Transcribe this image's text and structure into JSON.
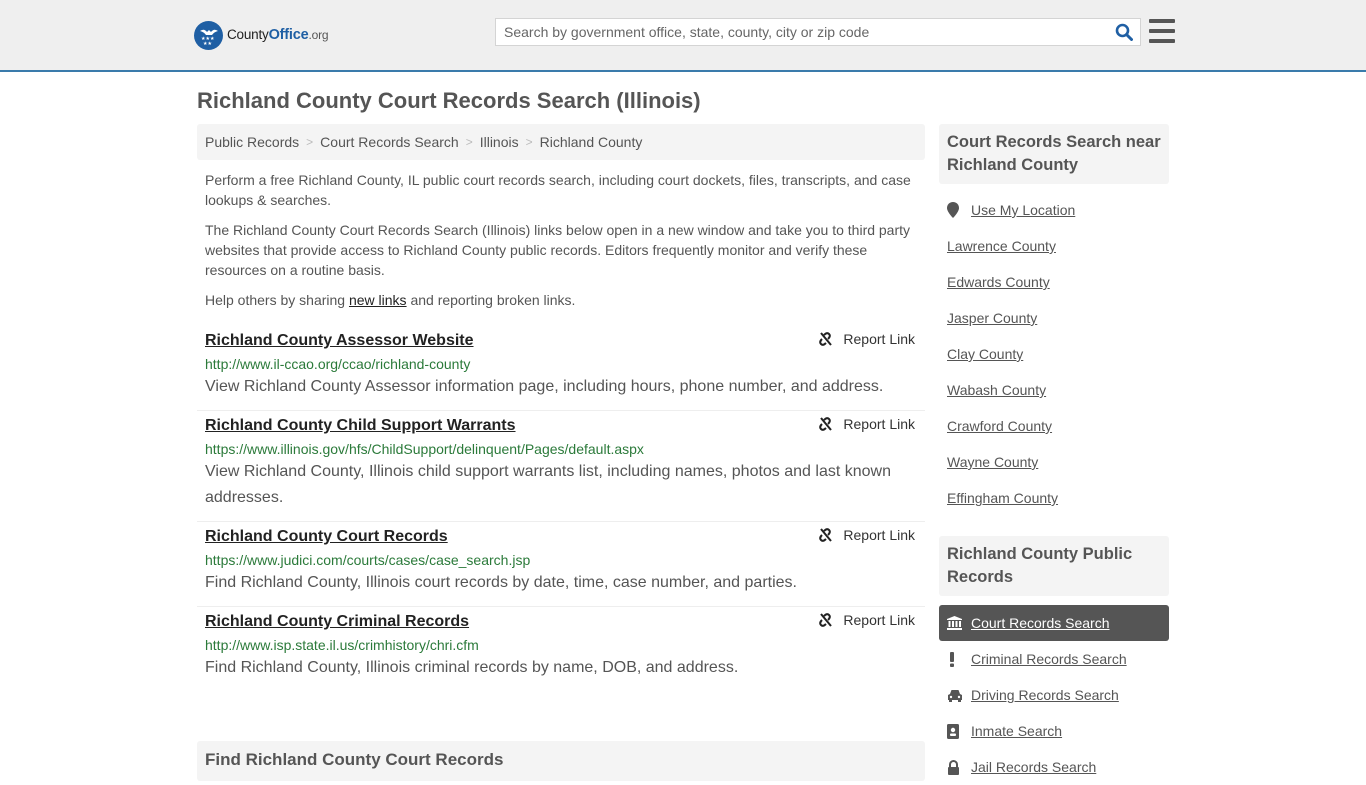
{
  "header": {
    "logo": {
      "name": "County",
      "accent": "Office",
      "tld": ".org"
    },
    "search_placeholder": "Search by government office, state, county, city or zip code"
  },
  "page_title": "Richland County Court Records Search (Illinois)",
  "breadcrumb": [
    "Public Records",
    "Court Records Search",
    "Illinois",
    "Richland County"
  ],
  "intro": {
    "p1": "Perform a free Richland County, IL public court records search, including court dockets, files, transcripts, and case lookups & searches.",
    "p2": "The Richland County Court Records Search (Illinois) links below open in a new window and take you to third party websites that provide access to Richland County public records. Editors frequently monitor and verify these resources on a routine basis.",
    "p3_before": "Help others by sharing ",
    "p3_link": "new links",
    "p3_after": " and reporting broken links."
  },
  "report_label": "Report Link",
  "links": [
    {
      "title": "Richland County Assessor Website",
      "url": "http://www.il-ccao.org/ccao/richland-county",
      "desc": "View Richland County Assessor information page, including hours, phone number, and address."
    },
    {
      "title": "Richland County Child Support Warrants",
      "url": "https://www.illinois.gov/hfs/ChildSupport/delinquent/Pages/default.aspx",
      "desc": "View Richland County, Illinois child support warrants list, including names, photos and last known addresses."
    },
    {
      "title": "Richland County Court Records",
      "url": "https://www.judici.com/courts/cases/case_search.jsp",
      "desc": "Find Richland County, Illinois court records by date, time, case number, and parties."
    },
    {
      "title": "Richland County Criminal Records",
      "url": "http://www.isp.state.il.us/crimhistory/chri.cfm",
      "desc": "Find Richland County, Illinois criminal records by name, DOB, and address."
    }
  ],
  "find_heading": "Find Richland County Court Records",
  "sidebar": {
    "nearby_heading": "Court Records Search near Richland County",
    "use_location": "Use My Location",
    "nearby": [
      "Lawrence County",
      "Edwards County",
      "Jasper County",
      "Clay County",
      "Wabash County",
      "Crawford County",
      "Wayne County",
      "Effingham County"
    ],
    "public_heading": "Richland County Public Records",
    "public_records": [
      {
        "label": "Court Records Search",
        "icon": "courthouse-icon",
        "active": true
      },
      {
        "label": "Criminal Records Search",
        "icon": "exclamation-icon",
        "active": false
      },
      {
        "label": "Driving Records Search",
        "icon": "car-icon",
        "active": false
      },
      {
        "label": "Inmate Search",
        "icon": "id-badge-icon",
        "active": false
      },
      {
        "label": "Jail Records Search",
        "icon": "lock-icon",
        "active": false
      }
    ]
  },
  "colors": {
    "brand_blue": "#1f5fa4",
    "header_border": "#3a7bab",
    "url_green": "#2b7a3a",
    "active_bg": "#555555"
  }
}
